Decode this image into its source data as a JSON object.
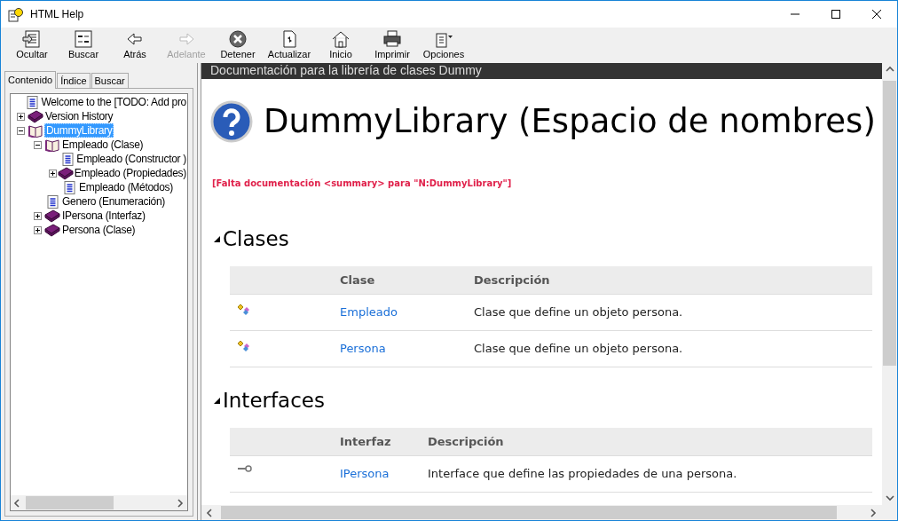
{
  "window": {
    "title": "HTML Help"
  },
  "toolbar": [
    {
      "label": "Ocultar",
      "kind": "hide",
      "disabled": false
    },
    {
      "label": "Buscar",
      "kind": "locate",
      "disabled": false
    },
    {
      "label": "Atrás",
      "kind": "back",
      "disabled": false
    },
    {
      "label": "Adelante",
      "kind": "forward",
      "disabled": true
    },
    {
      "label": "Detener",
      "kind": "stop",
      "disabled": false
    },
    {
      "label": "Actualizar",
      "kind": "refresh",
      "disabled": false
    },
    {
      "label": "Inicio",
      "kind": "home",
      "disabled": false
    },
    {
      "label": "Imprimir",
      "kind": "print",
      "disabled": false
    },
    {
      "label": "Opciones",
      "kind": "options",
      "disabled": false
    }
  ],
  "tabs": [
    {
      "label": "Contenido",
      "selected": true
    },
    {
      "label": "Índice",
      "selected": false
    },
    {
      "label": "Buscar",
      "selected": false
    }
  ],
  "tree": [
    {
      "label": "Welcome to the [TODO: Add pro",
      "kind": "page",
      "selected": false
    },
    {
      "label": "Version History",
      "kind": "book",
      "expanded": false,
      "selected": false
    },
    {
      "label": "DummyLibrary",
      "kind": "book",
      "expanded": true,
      "selected": true,
      "children": [
        {
          "label": "Empleado (Clase)",
          "kind": "book",
          "expanded": true,
          "selected": false,
          "children": [
            {
              "label": "Empleado (Constructor )",
              "kind": "page",
              "selected": false
            },
            {
              "label": "Empleado (Propiedades)",
              "kind": "book",
              "expanded": false,
              "selected": false
            },
            {
              "label": "Empleado (Métodos)",
              "kind": "page",
              "selected": false
            }
          ]
        },
        {
          "label": "Genero (Enumeración)",
          "kind": "page",
          "selected": false
        },
        {
          "label": "IPersona (Interfaz)",
          "kind": "book",
          "expanded": false,
          "selected": false
        },
        {
          "label": "Persona (Clase)",
          "kind": "book",
          "expanded": false,
          "selected": false
        }
      ]
    }
  ],
  "content": {
    "banner": "Documentación para la librería de clases Dummy",
    "title": "DummyLibrary (Espacio de nombres)",
    "warning": "[Falta documentación <summary> para \"N:DummyLibrary\"]",
    "sections": [
      {
        "heading": "Clases",
        "columns": [
          "Clase",
          "Descripción"
        ],
        "rows": [
          {
            "kind": "class",
            "name": "Empleado",
            "description": "Clase que define un objeto persona."
          },
          {
            "kind": "class",
            "name": "Persona",
            "description": "Clase que define un objeto persona."
          }
        ]
      },
      {
        "heading": "Interfaces",
        "columns": [
          "Interfaz",
          "Descripción"
        ],
        "rows": [
          {
            "kind": "interface",
            "name": "IPersona",
            "description": "Interface que define las propiedades de una persona."
          }
        ]
      }
    ]
  }
}
